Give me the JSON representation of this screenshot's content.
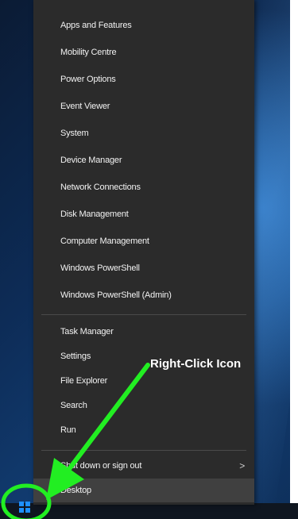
{
  "context_menu": {
    "group1": [
      "Apps and Features",
      "Mobility Centre",
      "Power Options",
      "Event Viewer",
      "System",
      "Device Manager",
      "Network Connections",
      "Disk Management",
      "Computer Management",
      "Windows PowerShell",
      "Windows PowerShell (Admin)"
    ],
    "group2": [
      "Task Manager",
      "Settings",
      "File Explorer",
      "Search",
      "Run"
    ],
    "shutdown_label": "Shut down or sign out",
    "shutdown_arrow": ">",
    "desktop_label": "Desktop"
  },
  "annotation": {
    "label": "Right-Click Icon",
    "color": "#22ee22"
  },
  "icons": {
    "start": "windows-logo-icon",
    "submenu": "chevron-right-icon"
  }
}
